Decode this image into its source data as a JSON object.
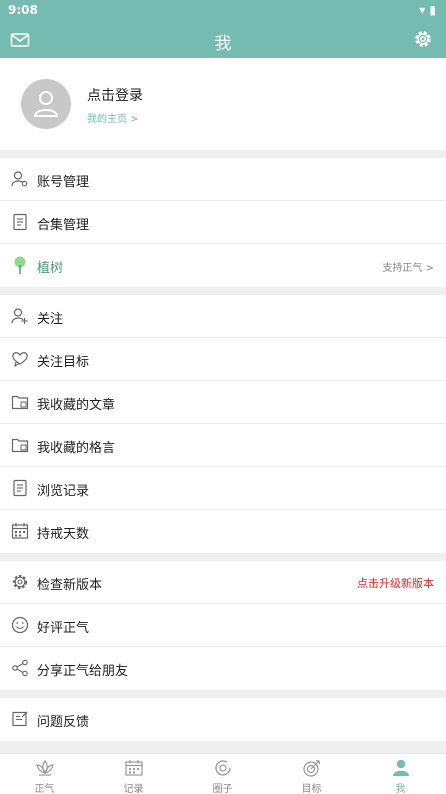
{
  "statusbar": {
    "time": "9:08",
    "indicators": "▾ ▮"
  },
  "header": {
    "title": "我",
    "left_icon": "mail-icon",
    "right_icon": "gear-icon"
  },
  "profile": {
    "login": "点击登录",
    "homepage": "我的主页 >"
  },
  "group1": [
    {
      "label": "账号管理",
      "icon": "account-icon"
    },
    {
      "label": "合集管理",
      "icon": "collection-icon"
    },
    {
      "label": "植树",
      "icon": "tree-icon",
      "right": "支持正气 >"
    }
  ],
  "group2": [
    {
      "label": "关注",
      "icon": "follow-icon"
    },
    {
      "label": "关注目标",
      "icon": "heart-chat-icon"
    },
    {
      "label": "我收藏的文章",
      "icon": "folder-icon"
    },
    {
      "label": "我收藏的格言",
      "icon": "folder-icon"
    },
    {
      "label": "浏览记录",
      "icon": "document-icon"
    },
    {
      "label": "持戒天数",
      "icon": "calendar-icon"
    }
  ],
  "group3": [
    {
      "label": "检查新版本",
      "icon": "settings-icon",
      "right": "点击升级新版本"
    },
    {
      "label": "好评正气",
      "icon": "smile-icon"
    },
    {
      "label": "分享正气给朋友",
      "icon": "share-icon"
    }
  ],
  "group4": [
    {
      "label": "问题反馈",
      "icon": "feedback-icon"
    }
  ],
  "tabs": [
    {
      "label": "正气",
      "icon": "lotus-icon"
    },
    {
      "label": "记录",
      "icon": "calendar-icon"
    },
    {
      "label": "圈子",
      "icon": "circle-icon"
    },
    {
      "label": "目标",
      "icon": "target-icon"
    },
    {
      "label": "我",
      "icon": "person-icon",
      "active": true
    }
  ],
  "colors": {
    "brand": "#75bbb2",
    "update_text": "#e0262c",
    "tree": "#8fd98a"
  }
}
